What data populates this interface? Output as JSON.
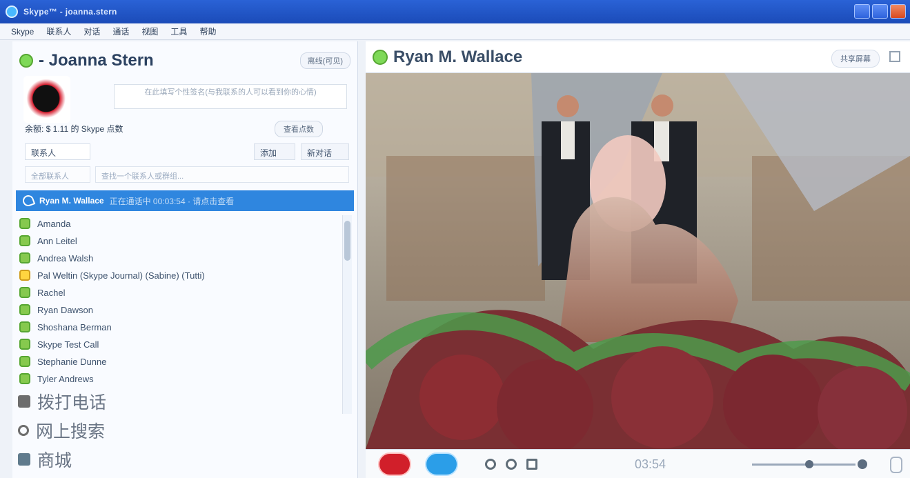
{
  "window": {
    "title": "Skype™ - joanna.stern"
  },
  "menu": [
    "Skype",
    "联系人",
    "对话",
    "通话",
    "视图",
    "工具",
    "帮助"
  ],
  "profile": {
    "name": "- Joanna Stern",
    "status_button": "离线(可见)",
    "mood_placeholder": "在此填写个性签名(与我联系的人可以看到你的心情)",
    "credit_line": "余额: $ 1.11 的 Skype 点数",
    "credit_button": "查看点数"
  },
  "controls": {
    "view_select": "联系人",
    "add_button": "添加",
    "new_button": "新对话",
    "search_left": "全部联系人",
    "search_placeholder": "查找一个联系人或群组..."
  },
  "active_call": {
    "name": "Ryan M. Wallace",
    "detail": "正在通话中 00:03:54 · 请点击查看"
  },
  "contacts": [
    {
      "name": "Amanda",
      "status": "online"
    },
    {
      "name": "Ann Leitel",
      "status": "online"
    },
    {
      "name": "Andrea Walsh",
      "status": "online"
    },
    {
      "name": "Pal Weltin (Skype Journal) (Sabine) (Tutti)",
      "status": "away"
    },
    {
      "name": "Rachel",
      "status": "online"
    },
    {
      "name": "Ryan Dawson",
      "status": "online"
    },
    {
      "name": "Shoshana Berman",
      "status": "online"
    },
    {
      "name": "Skype Test Call",
      "status": "online"
    },
    {
      "name": "Stephanie Dunne",
      "status": "online"
    },
    {
      "name": "Tyler Andrews",
      "status": "online"
    }
  ],
  "bottom_links": [
    {
      "label": "拨打电话"
    },
    {
      "label": "网上搜索"
    },
    {
      "label": "商城"
    }
  ],
  "call": {
    "title": "Ryan M. Wallace",
    "head_button": "共享屏幕",
    "timer": "03:54",
    "volume_level": 0.55
  },
  "colors": {
    "accent": "#2f86df",
    "hangup": "#d11f2a",
    "video": "#2b9ee8"
  }
}
